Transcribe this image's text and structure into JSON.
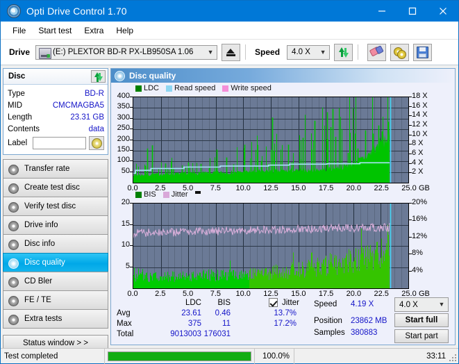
{
  "window": {
    "title": "Opti Drive Control 1.70",
    "minimize": "—",
    "maximize": "☐",
    "close": "✕"
  },
  "menu": {
    "items": [
      "File",
      "Start test",
      "Extra",
      "Help"
    ]
  },
  "toolbar": {
    "drive_label": "Drive",
    "drive_value": "(E:)   PLEXTOR BD-R  PX-LB950SA 1.06",
    "speed_label": "Speed",
    "speed_value": "4.0 X",
    "eject_icon": "eject-icon",
    "refresh_icon": "refresh-icon",
    "erase_icon": "eraser-icon",
    "discs_icon": "discs-icon",
    "save_icon": "save-icon"
  },
  "disc_panel": {
    "header": "Disc",
    "refresh_icon": "refresh-icon",
    "rows": [
      {
        "key": "Type",
        "value": "BD-R"
      },
      {
        "key": "MID",
        "value": "CMCMAGBA5"
      },
      {
        "key": "Length",
        "value": "23.31 GB"
      },
      {
        "key": "Contents",
        "value": "data"
      }
    ],
    "label_key": "Label",
    "label_value": "",
    "label_button_icon": "disc-icon"
  },
  "sidebar": {
    "items": [
      {
        "label": "Transfer rate",
        "selected": false
      },
      {
        "label": "Create test disc",
        "selected": false
      },
      {
        "label": "Verify test disc",
        "selected": false
      },
      {
        "label": "Drive info",
        "selected": false
      },
      {
        "label": "Disc info",
        "selected": false
      },
      {
        "label": "Disc quality",
        "selected": true
      },
      {
        "label": "CD Bler",
        "selected": false
      },
      {
        "label": "FE / TE",
        "selected": false
      },
      {
        "label": "Extra tests",
        "selected": false
      }
    ],
    "status_window_button": "Status window > >"
  },
  "content": {
    "header_title": "Disc quality",
    "header_icon": "disc-quality-icon"
  },
  "chart_data": [
    {
      "type": "area",
      "title": "LDC / Read speed",
      "legend": [
        {
          "label": "LDC",
          "color": "#008000"
        },
        {
          "label": "Read speed",
          "color": "#8ed6f2"
        },
        {
          "label": "Write speed",
          "color": "#f58fd8"
        }
      ],
      "xlabel": "GB",
      "x_ticks": [
        "0.0",
        "2.5",
        "5.0",
        "7.5",
        "10.0",
        "12.5",
        "15.0",
        "17.5",
        "20.0",
        "22.5",
        "25.0"
      ],
      "xlim": [
        0,
        25
      ],
      "ylabel_left": "LDC",
      "y_ticks_left": [
        "50",
        "100",
        "150",
        "200",
        "250",
        "300",
        "350",
        "400"
      ],
      "ylim_left": [
        0,
        400
      ],
      "ylabel_right": "Speed",
      "y_ticks_right": [
        "2 X",
        "4 X",
        "6 X",
        "8 X",
        "10 X",
        "12 X",
        "14 X",
        "16 X",
        "18 X"
      ],
      "ylim_right": [
        0,
        18
      ],
      "grid": true,
      "data_end_gb": 23.3,
      "series": [
        {
          "name": "LDC",
          "color": "#00c000",
          "baseline": [
            38,
            36,
            37,
            38,
            38,
            40,
            39,
            41,
            40,
            42,
            41,
            43,
            42,
            44,
            43,
            45,
            44,
            46,
            45,
            47,
            46,
            48,
            47,
            49,
            48,
            50,
            49,
            51,
            50,
            52,
            51,
            53,
            52,
            54,
            53,
            55,
            54,
            56,
            55,
            57,
            56,
            58,
            57,
            59,
            58,
            60,
            62,
            64,
            66,
            68,
            70,
            74,
            78,
            84,
            90,
            98,
            108,
            120,
            135,
            152,
            170,
            190,
            205,
            215
          ],
          "spikes": [
            {
              "x": 1.1,
              "y": 78
            },
            {
              "x": 1.25,
              "y": 160
            },
            {
              "x": 1.7,
              "y": 175
            },
            {
              "x": 2.9,
              "y": 90
            },
            {
              "x": 3.6,
              "y": 70
            },
            {
              "x": 4.4,
              "y": 63
            },
            {
              "x": 5.0,
              "y": 95
            },
            {
              "x": 6.1,
              "y": 88
            },
            {
              "x": 6.9,
              "y": 68
            },
            {
              "x": 7.55,
              "y": 155
            },
            {
              "x": 8.45,
              "y": 118
            },
            {
              "x": 9.1,
              "y": 86
            },
            {
              "x": 10.1,
              "y": 178
            },
            {
              "x": 11.0,
              "y": 78
            },
            {
              "x": 11.6,
              "y": 102
            },
            {
              "x": 12.3,
              "y": 88
            },
            {
              "x": 12.6,
              "y": 305
            },
            {
              "x": 13.4,
              "y": 95
            },
            {
              "x": 14.05,
              "y": 178
            },
            {
              "x": 14.4,
              "y": 96
            },
            {
              "x": 15.2,
              "y": 110
            },
            {
              "x": 15.4,
              "y": 210
            },
            {
              "x": 16.5,
              "y": 290
            },
            {
              "x": 17.6,
              "y": 330
            },
            {
              "x": 17.9,
              "y": 260
            },
            {
              "x": 18.15,
              "y": 345
            },
            {
              "x": 18.4,
              "y": 215
            },
            {
              "x": 19.5,
              "y": 140
            },
            {
              "x": 20.4,
              "y": 160
            },
            {
              "x": 21.1,
              "y": 245
            },
            {
              "x": 21.8,
              "y": 230
            },
            {
              "x": 22.3,
              "y": 268
            },
            {
              "x": 22.6,
              "y": 240
            },
            {
              "x": 23.2,
              "y": 285
            }
          ]
        },
        {
          "name": "Read speed",
          "color": "#a6e2f7",
          "steps": [
            {
              "x0": 0.0,
              "x1": 0.2,
              "y": 2.0
            },
            {
              "x0": 0.2,
              "x1": 1.6,
              "y": 2.6
            },
            {
              "x0": 1.6,
              "x1": 4.6,
              "y": 3.0
            },
            {
              "x0": 4.6,
              "x1": 7.9,
              "y": 3.3
            },
            {
              "x0": 7.9,
              "x1": 12.3,
              "y": 3.5
            },
            {
              "x0": 12.3,
              "x1": 14.2,
              "y": 3.7
            },
            {
              "x0": 14.2,
              "x1": 17.6,
              "y": 3.9
            },
            {
              "x0": 17.6,
              "x1": 20.6,
              "y": 4.0
            },
            {
              "x0": 20.6,
              "x1": 23.3,
              "y": 4.2
            }
          ]
        }
      ],
      "cursor_gb": 23.35,
      "cursor_color": "#45d5f5"
    },
    {
      "type": "area",
      "title": "BIS / Jitter",
      "legend": [
        {
          "label": "BIS",
          "color": "#008000"
        },
        {
          "label": "Jitter",
          "color": "#d9a8d9"
        }
      ],
      "xlabel": "GB",
      "x_ticks": [
        "0.0",
        "2.5",
        "5.0",
        "7.5",
        "10.0",
        "12.5",
        "15.0",
        "17.5",
        "20.0",
        "22.5",
        "25.0"
      ],
      "xlim": [
        0,
        25
      ],
      "ylabel_left": "BIS",
      "y_ticks_left": [
        "5",
        "10",
        "15",
        "20"
      ],
      "ylim_left": [
        0,
        20
      ],
      "ylabel_right": "Jitter",
      "y_ticks_right": [
        "4%",
        "8%",
        "12%",
        "16%",
        "20%"
      ],
      "ylim_right": [
        0,
        20
      ],
      "grid": true,
      "data_end_gb": 23.3,
      "series": [
        {
          "name": "BIS",
          "color": "#00c000",
          "baseline": [
            2.6,
            2.5,
            2.6,
            2.7,
            2.6,
            2.7,
            2.6,
            2.8,
            2.7,
            2.8,
            2.7,
            2.9,
            2.8,
            2.9,
            2.8,
            3.0,
            2.9,
            3.0,
            2.9,
            3.1,
            3.0,
            3.1,
            3.0,
            3.2,
            3.1,
            3.2,
            3.1,
            3.3,
            3.2,
            3.4,
            3.3,
            3.5,
            3.4,
            3.6,
            3.5,
            3.8,
            3.7,
            4.0,
            3.9,
            4.2,
            4.1,
            4.4,
            4.3,
            4.6,
            4.5,
            4.9,
            4.8,
            5.2,
            5.1,
            5.5,
            5.4,
            5.9,
            5.8,
            6.3,
            6.2,
            6.7,
            6.6,
            7.1,
            7.0,
            7.5,
            7.4,
            7.9,
            8.2,
            8.6
          ],
          "jitter_amp": 1.6
        },
        {
          "name": "Jitter",
          "color": "#d9a8d9",
          "mean": 13.6,
          "amplitude": 1.0,
          "trend_start": 13.0,
          "trend_end": 14.4
        }
      ],
      "cursor_gb": 23.35,
      "cursor_color": "#45d5f5"
    }
  ],
  "stats": {
    "col_headers": [
      "LDC",
      "BIS"
    ],
    "rows": [
      {
        "label": "Avg",
        "ldc": "23.61",
        "bis": "0.46",
        "jitter": "13.7%"
      },
      {
        "label": "Max",
        "ldc": "375",
        "bis": "11",
        "jitter": "17.2%"
      },
      {
        "label": "Total",
        "ldc": "9013003",
        "bis": "176031",
        "jitter": ""
      }
    ],
    "jitter_checkbox_label": "Jitter",
    "jitter_checked": true,
    "speed_label": "Speed",
    "speed_value": "4.19 X",
    "position_label": "Position",
    "position_value": "23862 MB",
    "samples_label": "Samples",
    "samples_value": "380883",
    "speed_select": "4.0 X",
    "start_full_button": "Start full",
    "start_part_button": "Start part"
  },
  "statusbar": {
    "message": "Test completed",
    "progress_percent": "100.0%",
    "progress_value": 100,
    "elapsed": "33:11"
  }
}
